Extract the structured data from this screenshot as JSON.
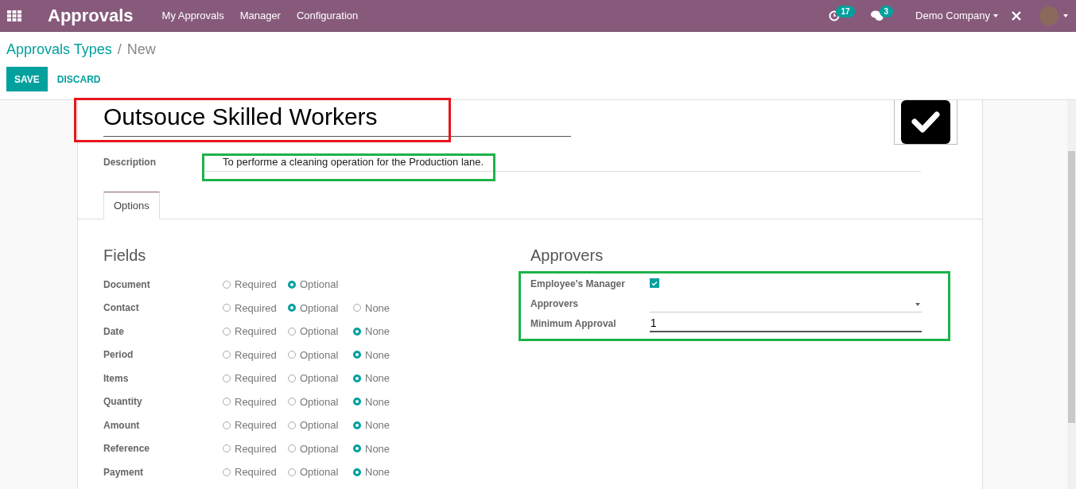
{
  "navbar": {
    "app_title": "Approvals",
    "menu": [
      "My Approvals",
      "Manager",
      "Configuration"
    ],
    "activity_badge": "17",
    "messages_badge": "3",
    "company": "Demo Company"
  },
  "breadcrumb": {
    "parent": "Approvals Types",
    "separator": "/",
    "current": "New"
  },
  "buttons": [
    "SAVE",
    "DISCARD"
  ],
  "form": {
    "name": "Outsouce Skilled Workers",
    "description_label": "Description",
    "description": "To performe a cleaning operation for the Production lane.",
    "tabs": [
      {
        "label": "Options",
        "selected": true
      }
    ],
    "fields_title": "Fields",
    "fields": [
      {
        "label": "Document",
        "options": [
          {
            "label": "Required",
            "selected": false
          },
          {
            "label": "Optional",
            "selected": true
          }
        ]
      },
      {
        "label": "Contact",
        "options": [
          {
            "label": "Required",
            "selected": false
          },
          {
            "label": "Optional",
            "selected": true
          },
          {
            "label": "None",
            "selected": false
          }
        ]
      },
      {
        "label": "Date",
        "options": [
          {
            "label": "Required",
            "selected": false
          },
          {
            "label": "Optional",
            "selected": false
          },
          {
            "label": "None",
            "selected": true
          }
        ]
      },
      {
        "label": "Period",
        "options": [
          {
            "label": "Required",
            "selected": false
          },
          {
            "label": "Optional",
            "selected": false
          },
          {
            "label": "None",
            "selected": true
          }
        ]
      },
      {
        "label": "Items",
        "options": [
          {
            "label": "Required",
            "selected": false
          },
          {
            "label": "Optional",
            "selected": false
          },
          {
            "label": "None",
            "selected": true
          }
        ]
      },
      {
        "label": "Quantity",
        "options": [
          {
            "label": "Required",
            "selected": false
          },
          {
            "label": "Optional",
            "selected": false
          },
          {
            "label": "None",
            "selected": true
          }
        ]
      },
      {
        "label": "Amount",
        "options": [
          {
            "label": "Required",
            "selected": false
          },
          {
            "label": "Optional",
            "selected": false
          },
          {
            "label": "None",
            "selected": true
          }
        ]
      },
      {
        "label": "Reference",
        "options": [
          {
            "label": "Required",
            "selected": false
          },
          {
            "label": "Optional",
            "selected": false
          },
          {
            "label": "None",
            "selected": true
          }
        ]
      },
      {
        "label": "Payment",
        "options": [
          {
            "label": "Required",
            "selected": false
          },
          {
            "label": "Optional",
            "selected": false
          },
          {
            "label": "None",
            "selected": true
          }
        ]
      }
    ],
    "approvers_title": "Approvers",
    "approvers": [
      {
        "kind": "checkbox",
        "label": "Employee's Manager",
        "checked": true
      },
      {
        "kind": "select",
        "label": "Approvers"
      },
      {
        "kind": "input",
        "label": "Minimum Approval",
        "value": "1"
      }
    ]
  },
  "highlights": [
    {
      "color": "#e8141b"
    },
    {
      "color": "#1db34a"
    },
    {
      "color": "#1db34a"
    }
  ]
}
